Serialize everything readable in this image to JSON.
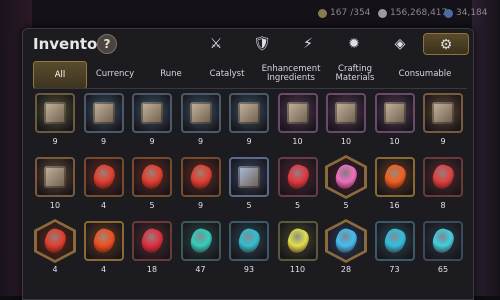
{
  "top_bar": {
    "energy": "167",
    "energy_max": "/354",
    "silver": "156,268,417",
    "gems": "34,184"
  },
  "window": {
    "title": "Inventory",
    "help_label": "?"
  },
  "category_icons": [
    {
      "name": "weapon-icon",
      "glyph": "⚔",
      "active": false
    },
    {
      "name": "armor-icon",
      "glyph": "🛡",
      "active": false
    },
    {
      "name": "artifact-icon",
      "glyph": "⚡",
      "active": false
    },
    {
      "name": "rune-icon",
      "glyph": "✹",
      "active": false
    },
    {
      "name": "material-icon",
      "glyph": "◈",
      "active": false
    },
    {
      "name": "consumable-icon",
      "glyph": "⚙",
      "active": true
    }
  ],
  "tabs": [
    {
      "label": "All",
      "active": true
    },
    {
      "label": "Currency",
      "active": false
    },
    {
      "label": "Rune",
      "active": false
    },
    {
      "label": "Catalyst",
      "active": false
    },
    {
      "label": "Enhancement Ingredients",
      "active": false
    },
    {
      "label": "Crafting Materials",
      "active": false
    },
    {
      "label": "Consumable",
      "active": false
    }
  ],
  "items": [
    {
      "icon": "rune-chest-icon",
      "qty": "9",
      "bg": "#5a5a30",
      "color": "#c8b8a0",
      "shape": "cube",
      "border": "#6a5a40"
    },
    {
      "icon": "rune-chest-icon",
      "qty": "9",
      "bg": "#3a5870",
      "color": "#c8b8a0",
      "shape": "cube",
      "border": "#4a5a6a"
    },
    {
      "icon": "rune-chest-icon",
      "qty": "9",
      "bg": "#3a5870",
      "color": "#c8b8a0",
      "shape": "cube",
      "border": "#4a5a6a"
    },
    {
      "icon": "rune-chest-icon",
      "qty": "9",
      "bg": "#3a5870",
      "color": "#c8b8a0",
      "shape": "cube",
      "border": "#4a5a6a"
    },
    {
      "icon": "rune-chest-icon",
      "qty": "9",
      "bg": "#3a5870",
      "color": "#c8b8a0",
      "shape": "cube",
      "border": "#4a5a6a"
    },
    {
      "icon": "rune-chest-icon",
      "qty": "10",
      "bg": "#5a3a5a",
      "color": "#c8b8a0",
      "shape": "cube",
      "border": "#6a4a6a"
    },
    {
      "icon": "rune-chest-icon",
      "qty": "10",
      "bg": "#5a3a5a",
      "color": "#c8b8a0",
      "shape": "cube",
      "border": "#6a4a6a"
    },
    {
      "icon": "rune-chest-icon",
      "qty": "10",
      "bg": "#5a3a5a",
      "color": "#c8b8a0",
      "shape": "cube",
      "border": "#6a4a6a"
    },
    {
      "icon": "rune-chest-icon",
      "qty": "9",
      "bg": "#6a4a30",
      "color": "#c8b8a0",
      "shape": "cube",
      "border": "#7a5a3a"
    },
    {
      "icon": "rune-chest-icon",
      "qty": "10",
      "bg": "#6a4a30",
      "color": "#c8b8a0",
      "shape": "cube",
      "border": "#7a5a3a"
    },
    {
      "icon": "red-rune-icon",
      "qty": "4",
      "bg": "#6a2a1a",
      "color": "#e04030",
      "shape": "gem",
      "border": "#7a4a2a"
    },
    {
      "icon": "red-rune-icon",
      "qty": "5",
      "bg": "#6a2a1a",
      "color": "#e04030",
      "shape": "gem",
      "border": "#7a4a2a"
    },
    {
      "icon": "red-rune-icon",
      "qty": "9",
      "bg": "#6a2a1a",
      "color": "#e04030",
      "shape": "gem",
      "border": "#7a4a2a"
    },
    {
      "icon": "silver-chest-icon",
      "qty": "5",
      "bg": "#3a4a6a",
      "color": "#b0c0e0",
      "shape": "cube",
      "border": "#5a6a8a"
    },
    {
      "icon": "red-rune-icon",
      "qty": "5",
      "bg": "#5a2530",
      "color": "#e03a40",
      "shape": "gem",
      "border": "#6a3a4a"
    },
    {
      "icon": "pink-potion-icon",
      "qty": "5",
      "bg": "#3a2030",
      "color": "#f070c0",
      "shape": "hex",
      "border": "#8a6a3a"
    },
    {
      "icon": "red-rune-icon",
      "qty": "16",
      "bg": "#6a3a1a",
      "color": "#f06020",
      "shape": "gem",
      "border": "#8a6a30"
    },
    {
      "icon": "red-rune-icon",
      "qty": "8",
      "bg": "#5a2a2a",
      "color": "#e04040",
      "shape": "gem",
      "border": "#6a3a3a"
    },
    {
      "icon": "red-rune-icon",
      "qty": "4",
      "bg": "#5a2a1a",
      "color": "#e04030",
      "shape": "hex",
      "border": "#8a6a3a"
    },
    {
      "icon": "red-rune-icon",
      "qty": "4",
      "bg": "#6a3a1a",
      "color": "#f05020",
      "shape": "gem",
      "border": "#8a6a30"
    },
    {
      "icon": "red-rune-icon",
      "qty": "18",
      "bg": "#5a2a2a",
      "color": "#e03040",
      "shape": "gem",
      "border": "#6a3a3a"
    },
    {
      "icon": "cyan-rune-icon",
      "qty": "47",
      "bg": "#2a4a4a",
      "color": "#30d0c0",
      "shape": "gem",
      "border": "#3a5a5a"
    },
    {
      "icon": "cyan-rune-icon",
      "qty": "93",
      "bg": "#2a4a5a",
      "color": "#30c0d0",
      "shape": "gem",
      "border": "#3a5a6a"
    },
    {
      "icon": "yellow-rune-icon",
      "qty": "110",
      "bg": "#4a4a2a",
      "color": "#e0e050",
      "shape": "gem",
      "border": "#5a5a3a"
    },
    {
      "icon": "cyan-rune-icon",
      "qty": "28",
      "bg": "#2a3a5a",
      "color": "#40c0f0",
      "shape": "hex",
      "border": "#8a6a3a"
    },
    {
      "icon": "cyan-rune-icon",
      "qty": "73",
      "bg": "#2a4a5a",
      "color": "#30c0e0",
      "shape": "gem",
      "border": "#3a5a6a"
    },
    {
      "icon": "cyan-rune-icon",
      "qty": "65",
      "bg": "#2a3a4a",
      "color": "#40d0e0",
      "shape": "gem",
      "border": "#3a4a5a"
    }
  ]
}
